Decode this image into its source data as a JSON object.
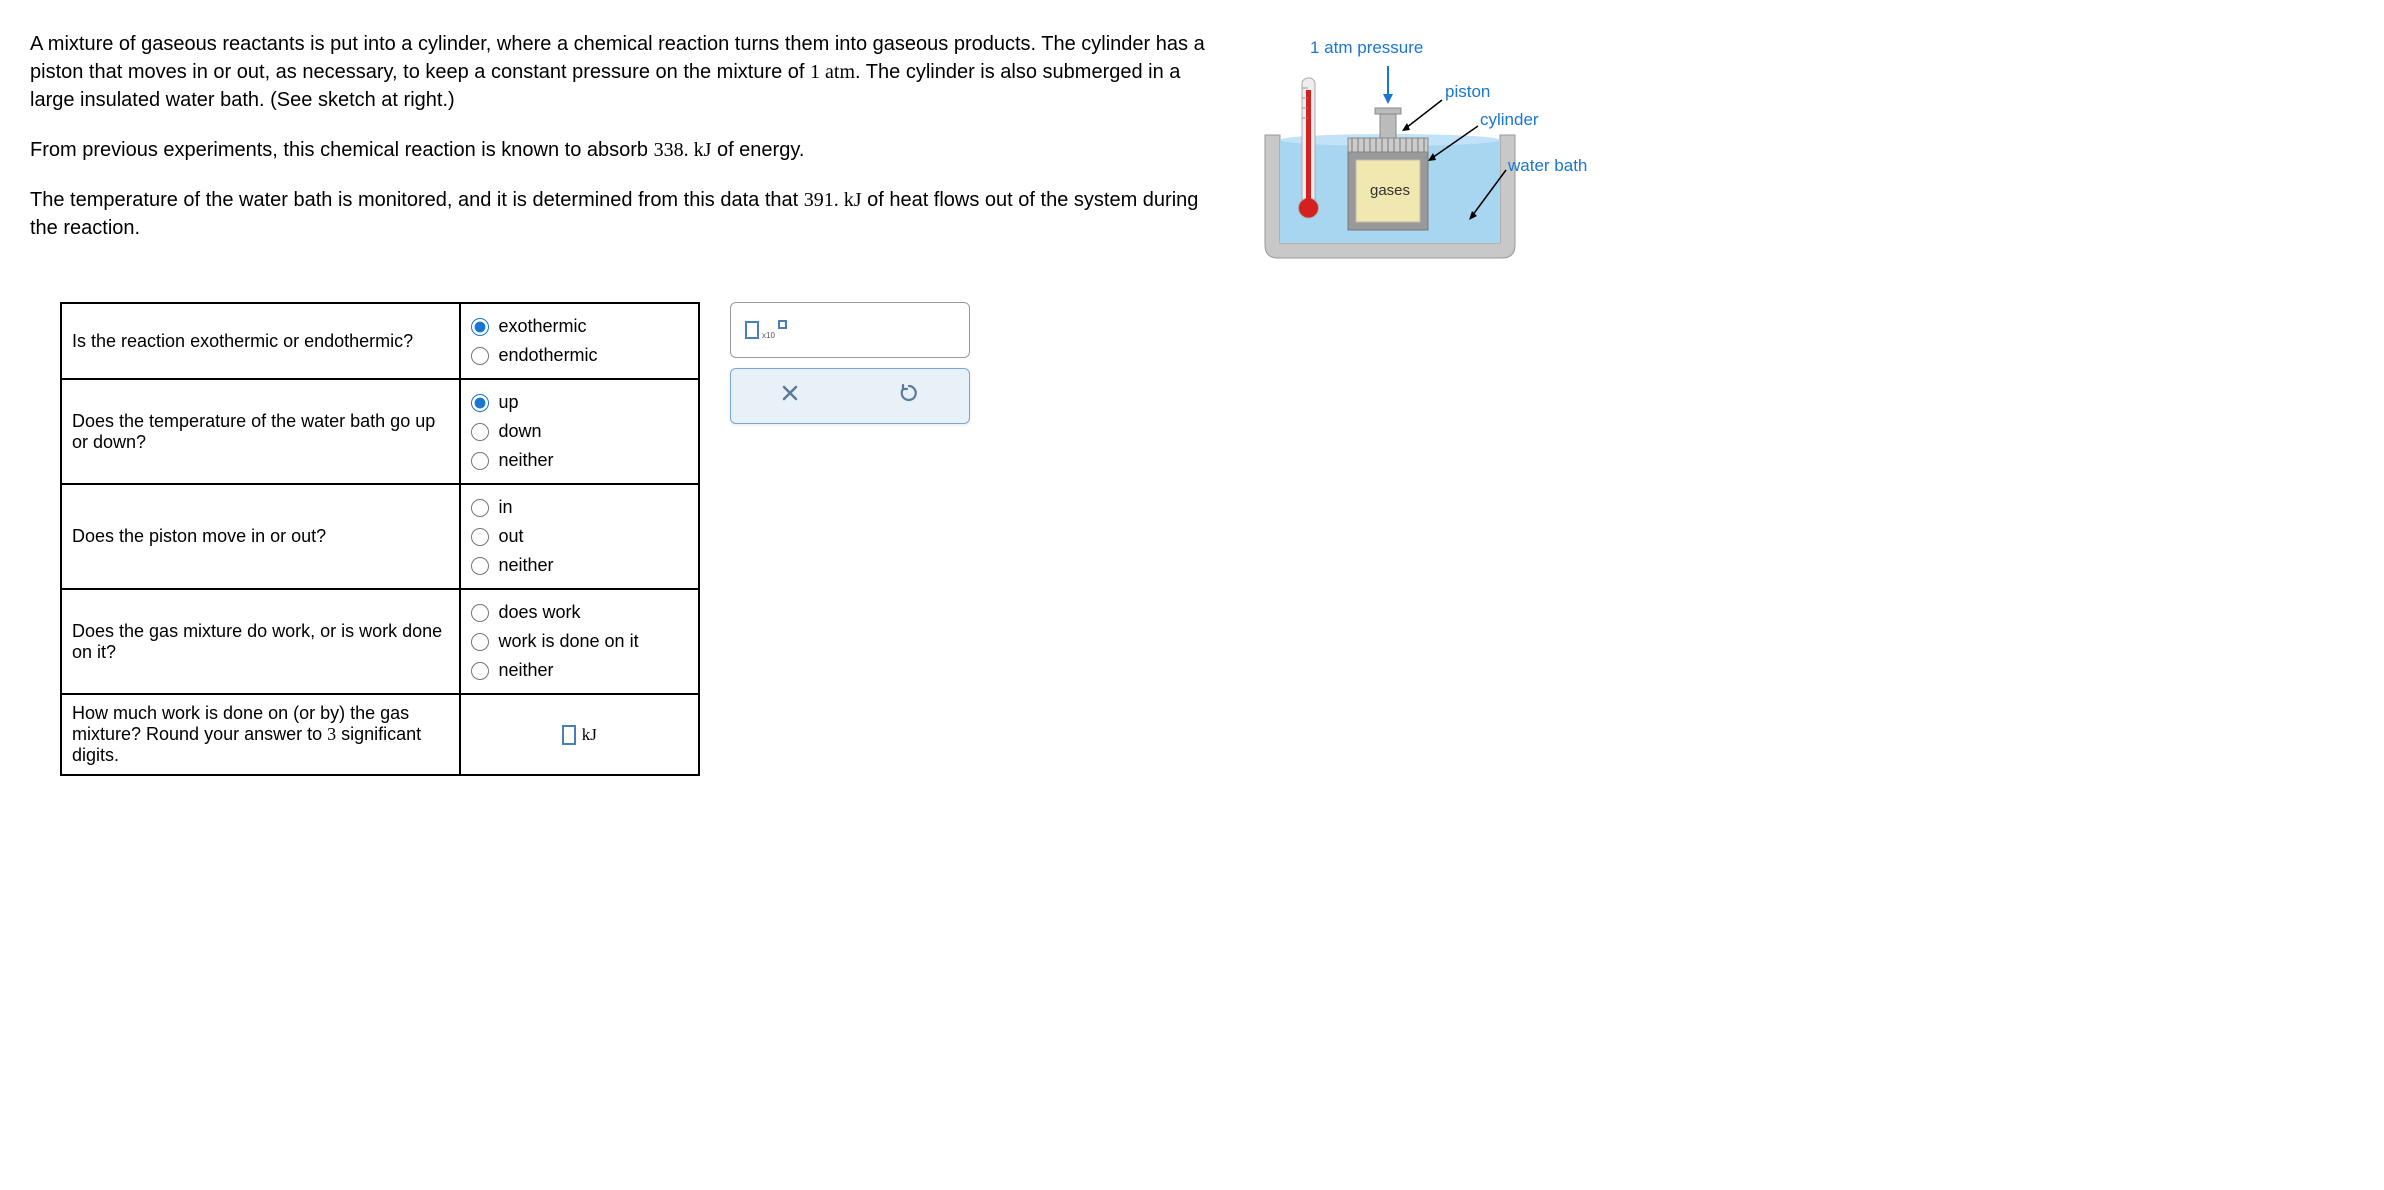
{
  "problem": {
    "p1_a": "A mixture of gaseous reactants is put into a cylinder, where a chemical reaction turns them into gaseous products. The cylinder has a piston that moves in or out, as necessary, to keep a constant pressure on the mixture of ",
    "p1_val": "1 atm",
    "p1_b": ". The cylinder is also submerged in a large insulated water bath. (See sketch at right.)",
    "p2_a": "From previous experiments, this chemical reaction is known to absorb ",
    "p2_val": "338. kJ",
    "p2_b": " of energy.",
    "p3_a": "The temperature of the water bath is monitored, and it is determined from this data that ",
    "p3_val": "391. kJ",
    "p3_b": " of heat flows out of the system during the reaction."
  },
  "questions": {
    "q1": {
      "text": "Is the reaction exothermic or endothermic?",
      "opts": [
        "exothermic",
        "endothermic"
      ],
      "selected": 0
    },
    "q2": {
      "text": "Does the temperature of the water bath go up or down?",
      "opts": [
        "up",
        "down",
        "neither"
      ],
      "selected": 0
    },
    "q3": {
      "text": "Does the piston move in or out?",
      "opts": [
        "in",
        "out",
        "neither"
      ],
      "selected": -1
    },
    "q4": {
      "text": "Does the gas mixture do work, or is work done on it?",
      "opts": [
        "does work",
        "work is done on it",
        "neither"
      ],
      "selected": -1
    },
    "q5": {
      "text_a": "How much work is done on (or by) the gas mixture? Round your answer to ",
      "text_val": "3",
      "text_b": " significant digits.",
      "unit": "kJ"
    }
  },
  "diagram": {
    "label_pressure": "1 atm pressure",
    "label_piston": "piston",
    "label_cylinder": "cylinder",
    "label_waterbath": "water bath",
    "label_gases": "gases"
  },
  "toolbar": {
    "x10": "x10"
  }
}
